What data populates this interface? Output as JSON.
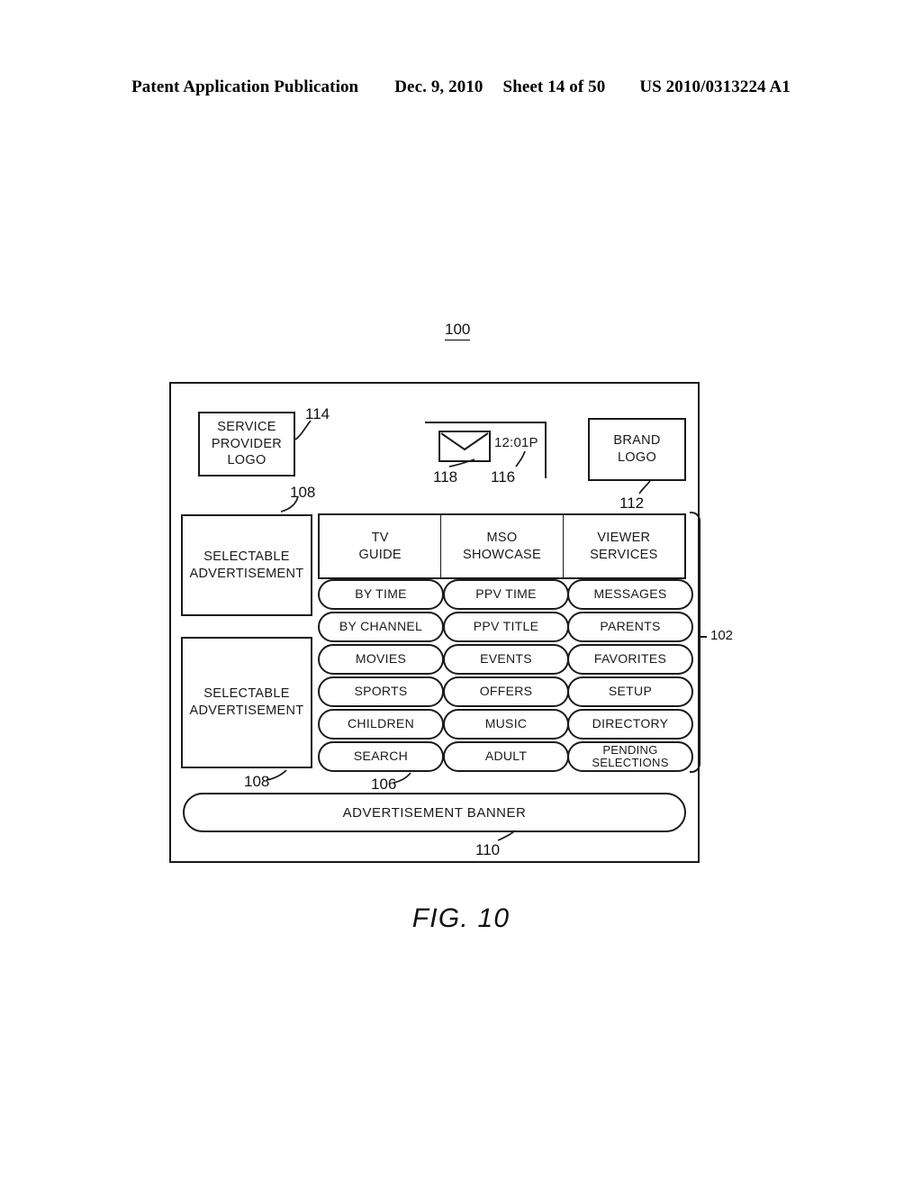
{
  "page_header": {
    "publication": "Patent Application Publication",
    "date": "Dec. 9, 2010",
    "sheet": "Sheet 14 of 50",
    "patent_number": "US 2010/0313224 A1"
  },
  "figure": {
    "caption": "FIG. 10",
    "figure_ref": "100",
    "screen": {
      "service_provider_logo": {
        "line1": "SERVICE",
        "line2": "PROVIDER",
        "line3": "LOGO",
        "ref": "114"
      },
      "status_bar": {
        "mail_icon": "envelope-icon",
        "mail_ref": "118",
        "clock_time": "12:01P",
        "clock_ref": "116"
      },
      "brand_logo": {
        "line1": "BRAND",
        "line2": "LOGO",
        "ref": "112"
      },
      "advertisements": [
        {
          "line1": "SELECTABLE",
          "line2": "ADVERTISEMENT",
          "ref": "108"
        },
        {
          "line1": "SELECTABLE",
          "line2": "ADVERTISEMENT",
          "ref": "108"
        }
      ],
      "category_headers": [
        {
          "line1": "TV",
          "line2": "GUIDE"
        },
        {
          "line1": "MSO",
          "line2": "SHOWCASE"
        },
        {
          "line1": "VIEWER",
          "line2": "SERVICES"
        }
      ],
      "menu_ref": "106",
      "menu_region_ref": "102",
      "menu_columns": [
        [
          "BY TIME",
          "BY CHANNEL",
          "MOVIES",
          "SPORTS",
          "CHILDREN",
          "SEARCH"
        ],
        [
          "PPV TIME",
          "PPV TITLE",
          "EVENTS",
          "OFFERS",
          "MUSIC",
          "ADULT"
        ],
        [
          "MESSAGES",
          "PARENTS",
          "FAVORITES",
          "SETUP",
          "DIRECTORY",
          "PENDING SELECTIONS"
        ]
      ],
      "banner": {
        "label": "ADVERTISEMENT BANNER",
        "ref": "110"
      }
    }
  }
}
